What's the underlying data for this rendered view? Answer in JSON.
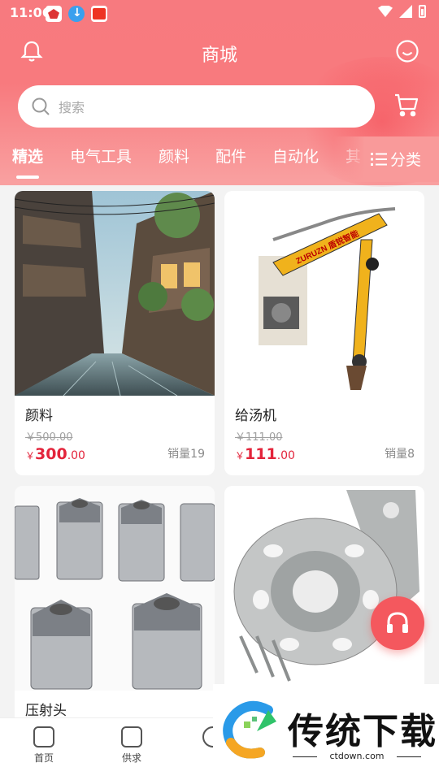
{
  "status_bar": {
    "time": "11:06"
  },
  "header": {
    "title": "商城"
  },
  "search": {
    "placeholder": "搜索"
  },
  "tabs": [
    {
      "label": "精选",
      "active": true
    },
    {
      "label": "电气工具"
    },
    {
      "label": "颜料"
    },
    {
      "label": "配件"
    },
    {
      "label": "自动化"
    },
    {
      "label": "其"
    }
  ],
  "category_button": {
    "label": "分类"
  },
  "products": [
    {
      "name": "颜料",
      "original_price": "￥500.00",
      "currency": "￥",
      "price_int": "300",
      "price_dec": ".00",
      "sales": "销量19"
    },
    {
      "name": "给汤机",
      "original_price": "￥111.00",
      "currency": "￥",
      "price_int": "111",
      "price_dec": ".00",
      "sales": "销量8"
    },
    {
      "name": "压射头"
    },
    {
      "name": ""
    }
  ],
  "image_text": {
    "robot_brand": "ZURUZN 盾锐智能"
  },
  "bottom_nav": [
    {
      "label": "首页",
      "icon": "home-icon"
    },
    {
      "label": "供求",
      "icon": "exchange-icon"
    },
    {
      "label": "",
      "icon": "bag-icon"
    }
  ],
  "watermark": {
    "title": "传统下载",
    "url": "ctdown.com"
  },
  "colors": {
    "accent": "#f77a7f",
    "price": "#e3243b",
    "float_button": "#f4585e"
  }
}
